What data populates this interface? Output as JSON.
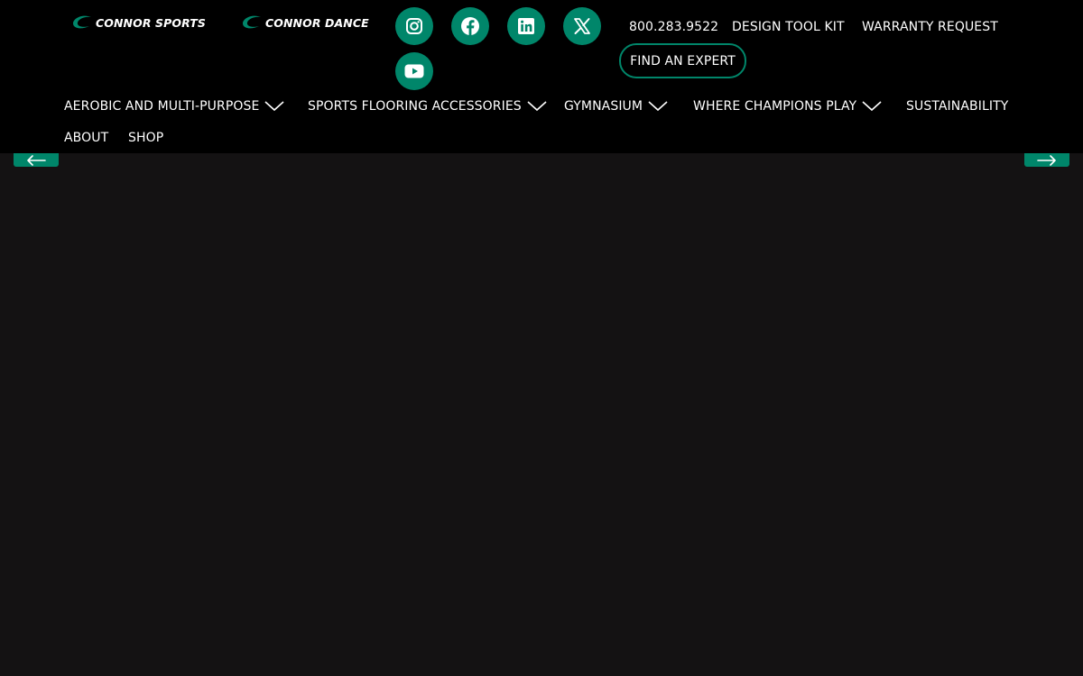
{
  "brands": {
    "sports": "CONNOR SPORTS",
    "dance": "CONNOR DANCE"
  },
  "social": [
    {
      "name": "Instagram",
      "icon": "instagram-icon"
    },
    {
      "name": "Facebook",
      "icon": "facebook-icon"
    },
    {
      "name": "LinkedIn",
      "icon": "linkedin-icon"
    },
    {
      "name": "X",
      "icon": "x-icon"
    },
    {
      "name": "YouTube",
      "icon": "youtube-icon"
    }
  ],
  "utility": {
    "phone": "800.283.9522",
    "design_tool_kit": "DESIGN TOOL KIT",
    "warranty_request": "WARRANTY REQUEST",
    "find_expert": "FIND AN EXPERT"
  },
  "nav": {
    "items": [
      {
        "label": "AEROBIC AND MULTI-PURPOSE",
        "has_dropdown": true
      },
      {
        "label": "SPORTS FLOORING ACCESSORIES",
        "has_dropdown": true
      },
      {
        "label": "GYMNASIUM",
        "has_dropdown": true
      },
      {
        "label": "WHERE CHAMPIONS PLAY",
        "has_dropdown": true
      },
      {
        "label": "SUSTAINABILITY",
        "has_dropdown": false
      },
      {
        "label": "ABOUT",
        "has_dropdown": false
      },
      {
        "label": "SHOP",
        "has_dropdown": false
      }
    ]
  },
  "carousel": {
    "prev_icon": "arrow-left-icon",
    "next_icon": "arrow-right-icon"
  },
  "colors": {
    "header_bg": "#000000",
    "accent": "#00866a",
    "hero_bg": "#141213",
    "text": "#ffffff"
  }
}
